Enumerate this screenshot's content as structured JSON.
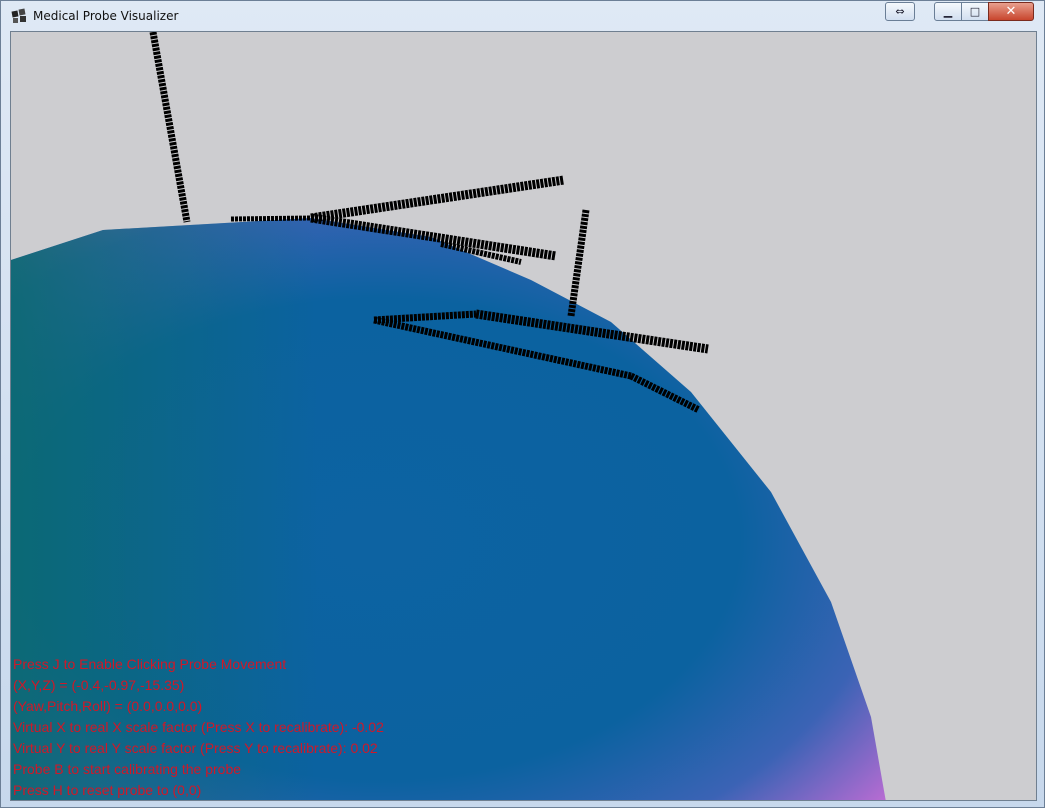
{
  "window": {
    "title": "Medical Probe Visualizer",
    "buttons": {
      "swap_glyph": "⇔",
      "minimize_glyph": "▁",
      "maximize_glyph": "□",
      "close_glyph": "✕"
    }
  },
  "viewport": {
    "background": "#cdcdd0",
    "sphere_colors": [
      "#0b6a70",
      "#0c62a0",
      "#c76dd6"
    ],
    "probe_color": "#000000"
  },
  "hud": {
    "color": "#d01828",
    "lines": [
      "Press J to Enable Clicking Probe Movement",
      "(X,Y,Z) = (-0.4,-0.97,-15.35)",
      "(Yaw,Pitch,Roll) = (0.0,0.0,0.0)",
      "Virtual X to real X scale factor (Press X to recalibrate): -0.02",
      "Virtual Y to real Y scale factor (Press Y to recalibrate): 0.02",
      "Probe B to start calibrating the probe",
      "Press H to reset probe to (0,0)"
    ]
  }
}
